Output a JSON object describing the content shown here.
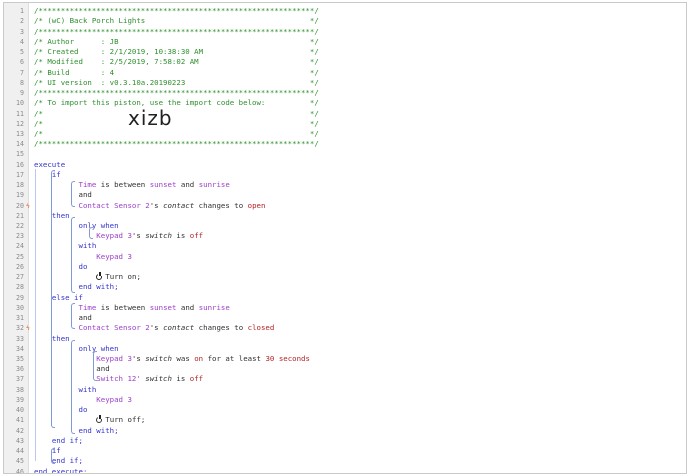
{
  "import_code": "xizb",
  "lines": [
    {
      "n": "1",
      "html": "<span class='cmt'>/**************************************************************/</span>"
    },
    {
      "n": "2",
      "html": "<span class='cmt'>/* (wC) Back Porch Lights                                     */</span>"
    },
    {
      "n": "3",
      "html": "<span class='cmt'>/**************************************************************/</span>"
    },
    {
      "n": "4",
      "html": "<span class='cmt'>/* Author      : JB                                           */</span>"
    },
    {
      "n": "5",
      "html": "<span class='cmt'>/* Created     : 2/1/2019, 10:38:30 AM                        */</span>"
    },
    {
      "n": "6",
      "html": "<span class='cmt'>/* Modified    : 2/5/2019, 7:58:02 AM                         */</span>"
    },
    {
      "n": "7",
      "html": "<span class='cmt'>/* Build       : 4                                            */</span>"
    },
    {
      "n": "8",
      "html": "<span class='cmt'>/* UI version  : v0.3.10a.20190223                            */</span>"
    },
    {
      "n": "9",
      "html": "<span class='cmt'>/**************************************************************/</span>"
    },
    {
      "n": "10",
      "html": "<span class='cmt'>/* To import this piston, use the import code below:          */</span>"
    },
    {
      "n": "11",
      "html": "<span class='cmt'>/*                                                            */</span>"
    },
    {
      "n": "12",
      "html": "<span class='cmt'>/*                                                            */</span>"
    },
    {
      "n": "13",
      "html": "<span class='cmt'>/*                                                            */</span>"
    },
    {
      "n": "14",
      "html": "<span class='cmt'>/**************************************************************/</span>"
    },
    {
      "n": "15",
      "html": ""
    },
    {
      "n": "16",
      "html": "<span class='kw'>execute</span>"
    },
    {
      "n": "17",
      "html": "    <span class='kw'>if</span>"
    },
    {
      "n": "18",
      "html": "          <span class='dev'>Time</span> <span class='plain'>is between</span> <span class='dev'>sunset</span> <span class='plain'>and</span> <span class='dev'>sunrise</span>"
    },
    {
      "n": "19",
      "html": "          <span class='plain'>and</span>"
    },
    {
      "n": "20",
      "mark": true,
      "html": "          <span class='dev'>Contact Sensor 2</span><span class='plain'>'s</span> <span class='attr'>contact</span> <span class='plain'>changes to</span> <span class='val'>open</span>"
    },
    {
      "n": "21",
      "html": "    <span class='kw'>then</span>"
    },
    {
      "n": "22",
      "html": "          <span class='kw'>only when</span>"
    },
    {
      "n": "23",
      "html": "              <span class='dev'>Keypad 3</span><span class='plain'>'s</span> <span class='attr'>switch</span> <span class='plain'>is</span> <span class='val'>off</span>"
    },
    {
      "n": "24",
      "html": "          <span class='kw'>with</span>"
    },
    {
      "n": "25",
      "html": "              <span class='dev'>Keypad 3</span>"
    },
    {
      "n": "26",
      "html": "          <span class='kw'>do</span>"
    },
    {
      "n": "27",
      "pwr": "on",
      "html": "              <span class='pwr'></span><span class='plain'>Turn on;</span>"
    },
    {
      "n": "28",
      "html": "          <span class='kw'>end with;</span>"
    },
    {
      "n": "29",
      "html": "    <span class='kw'>else if</span>"
    },
    {
      "n": "30",
      "html": "          <span class='dev'>Time</span> <span class='plain'>is between</span> <span class='dev'>sunset</span> <span class='plain'>and</span> <span class='dev'>sunrise</span>"
    },
    {
      "n": "31",
      "html": "          <span class='plain'>and</span>"
    },
    {
      "n": "32",
      "mark": true,
      "html": "          <span class='dev'>Contact Sensor 2</span><span class='plain'>'s</span> <span class='attr'>contact</span> <span class='plain'>changes to</span> <span class='val'>closed</span>"
    },
    {
      "n": "33",
      "html": "    <span class='kw'>then</span>"
    },
    {
      "n": "34",
      "html": "          <span class='kw'>only when</span>"
    },
    {
      "n": "35",
      "html": "              <span class='dev'>Keypad 3</span><span class='plain'>'s</span> <span class='attr'>switch</span> <span class='plain'>was</span> <span class='val'>on</span> <span class='plain'>for at least</span> <span class='num'>30</span> <span class='val'>seconds</span>"
    },
    {
      "n": "36",
      "html": "              <span class='plain'>and</span>"
    },
    {
      "n": "37",
      "html": "              <span class='dev'>Switch 12'</span> <span class='attr'>switch</span> <span class='plain'>is</span> <span class='val'>off</span>"
    },
    {
      "n": "38",
      "html": "          <span class='kw'>with</span>"
    },
    {
      "n": "39",
      "html": "              <span class='dev'>Keypad 3</span>"
    },
    {
      "n": "40",
      "html": "          <span class='kw'>do</span>"
    },
    {
      "n": "41",
      "html": "              <span class='pwr off'></span><span class='plain'>Turn off;</span>"
    },
    {
      "n": "42",
      "html": "          <span class='kw'>end with;</span>"
    },
    {
      "n": "43",
      "html": "    <span class='kw'>end if;</span>"
    },
    {
      "n": "44",
      "html": "    <span class='kw'>if</span>"
    },
    {
      "n": "45",
      "html": "    <span class='kw'>end if;</span>"
    },
    {
      "n": "46",
      "html": "<span class='kw'>end execute;</span>"
    }
  ]
}
